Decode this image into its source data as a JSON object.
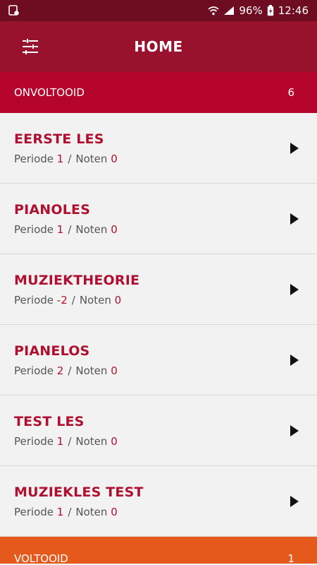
{
  "status": {
    "battery": "96%",
    "time": "12:46"
  },
  "appbar": {
    "title": "HOME"
  },
  "sections": {
    "incomplete": {
      "label": "ONVOLTOOID",
      "count": "6"
    },
    "complete": {
      "label": "VOLTOOID",
      "count": "1"
    }
  },
  "labels": {
    "periode": "Periode",
    "noten": "Noten",
    "separator": "/"
  },
  "lessons": [
    {
      "title": "EERSTE LES",
      "periode": "1",
      "noten": "0"
    },
    {
      "title": "PIANOLES",
      "periode": "1",
      "noten": "0"
    },
    {
      "title": "MUZIEKTHEORIE",
      "periode": "-2",
      "noten": "0"
    },
    {
      "title": "PIANELOS",
      "periode": "2",
      "noten": "0"
    },
    {
      "title": "TEST LES",
      "periode": "1",
      "noten": "0"
    },
    {
      "title": "MUZIEKLES TEST",
      "periode": "1",
      "noten": "0"
    }
  ],
  "colors": {
    "primary": "#98122e",
    "accent": "#b5052d",
    "complete": "#e55a1c"
  },
  "icons": {
    "menu": "sliders-menu-icon",
    "play": "play-arrow-icon"
  }
}
